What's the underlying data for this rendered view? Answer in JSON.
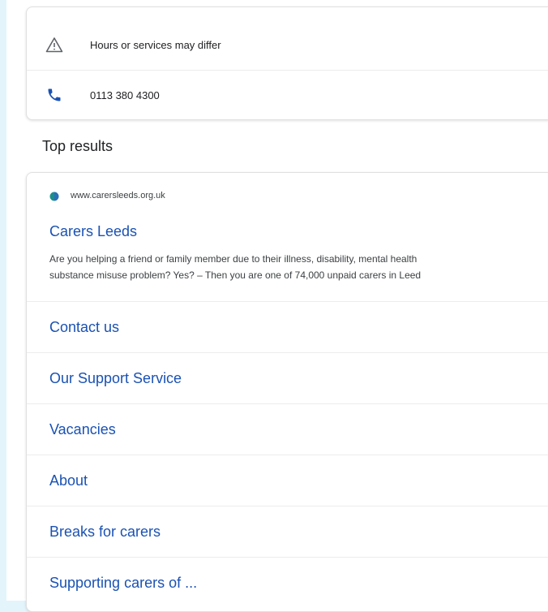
{
  "info_card": {
    "notice": "Hours or services may differ",
    "phone": "0113 380 4300",
    "notice_icon": "warning-icon",
    "phone_icon": "phone-icon"
  },
  "section_title": "Top results",
  "result": {
    "site_url": "www.carersleeds.org.uk",
    "title": "Carers Leeds",
    "snippet_line1": "Are you helping a friend or family member due to their illness, disability, mental health",
    "snippet_line2": "substance misuse problem? Yes? – Then you are one of 74,000 unpaid carers in Leed",
    "favicon_color": "#1b8f8a",
    "link_color": "#1a52b3",
    "sitelinks": [
      {
        "label": "Contact us"
      },
      {
        "label": "Our Support Service"
      },
      {
        "label": "Vacancies"
      },
      {
        "label": "About"
      },
      {
        "label": "Breaks for carers"
      },
      {
        "label": "Supporting carers of ..."
      }
    ]
  }
}
